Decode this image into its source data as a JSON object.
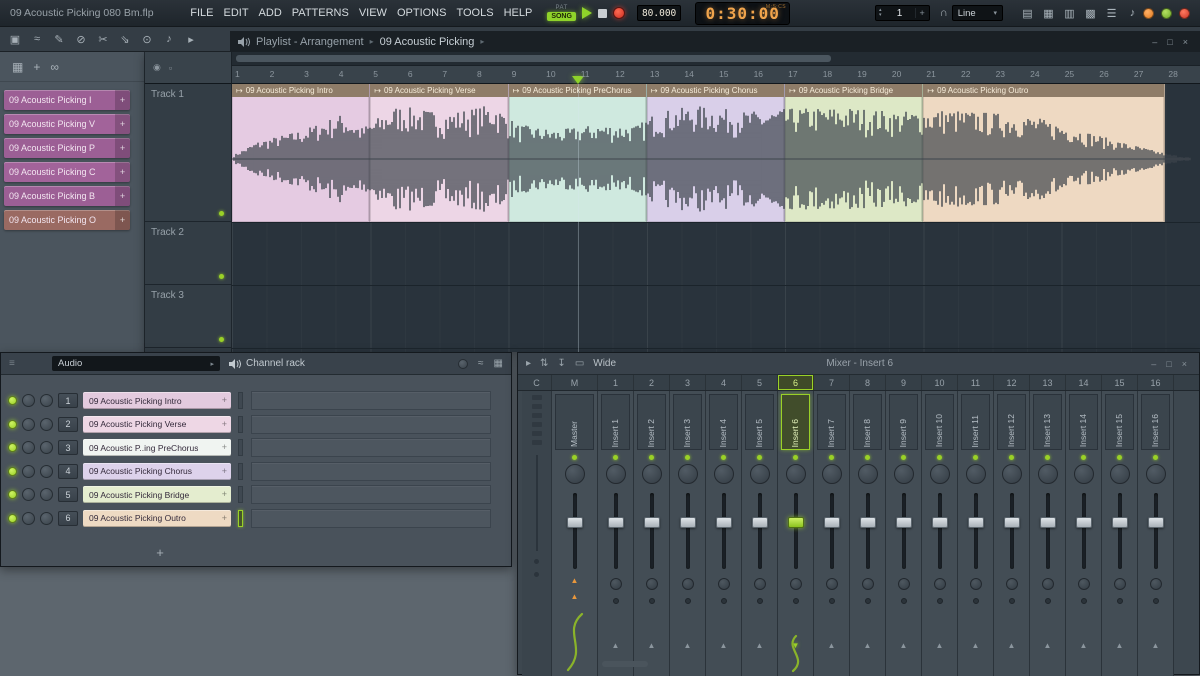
{
  "titlebar": {
    "app_title": "09 Acoustic Picking 080 Bm.flp",
    "menus": [
      "FILE",
      "EDIT",
      "ADD",
      "PATTERNS",
      "VIEW",
      "OPTIONS",
      "TOOLS",
      "HELP"
    ],
    "pat_label": "PAT",
    "song_label": "SONG",
    "tempo": "80.000",
    "time": "0:30:00",
    "time_unit": "M:S:CS",
    "pattern_number": "1",
    "snap_label": "Line",
    "panel_icons": [
      {
        "name": "playlist-toggle-icon",
        "glyph": "▤"
      },
      {
        "name": "piano-roll-toggle-icon",
        "glyph": "▦"
      },
      {
        "name": "channel-rack-toggle-icon",
        "glyph": "▥"
      },
      {
        "name": "mixer-toggle-icon",
        "glyph": "▩"
      },
      {
        "name": "browser-toggle-icon",
        "glyph": "☰"
      },
      {
        "name": "plugin-picker-icon",
        "glyph": "♪"
      }
    ]
  },
  "toolbar2": {
    "icons": [
      {
        "name": "select-tool-icon",
        "glyph": "▣"
      },
      {
        "name": "smooth-tool-icon",
        "glyph": "≈"
      },
      {
        "name": "draw-tool-icon",
        "glyph": "✎"
      },
      {
        "name": "mute-tool-icon",
        "glyph": "⊘"
      },
      {
        "name": "slice-tool-icon",
        "glyph": "✂"
      },
      {
        "name": "slip-tool-icon",
        "glyph": "⇘"
      },
      {
        "name": "zoom-tool-icon",
        "glyph": "⊙"
      },
      {
        "name": "preview-tool-icon",
        "glyph": "♪"
      },
      {
        "name": "playback-tool-icon",
        "glyph": "▸"
      }
    ]
  },
  "picker": {
    "tool_icons": [
      {
        "name": "piano-view-icon",
        "glyph": "▦"
      },
      {
        "name": "move-mode-icon",
        "glyph": "+"
      },
      {
        "name": "link-mode-icon",
        "glyph": "∞"
      }
    ],
    "patterns": [
      {
        "label": "09 Acoustic Picking I",
        "color": "#9c5f95"
      },
      {
        "label": "09 Acoustic Picking V",
        "color": "#a2639a"
      },
      {
        "label": "09 Acoustic Picking P",
        "color": "#9c5f95"
      },
      {
        "label": "09 Acoustic Picking C",
        "color": "#a2639a"
      },
      {
        "label": "09 Acoustic Picking B",
        "color": "#9c5f95"
      },
      {
        "label": "09 Acoustic Picking O",
        "color": "#9a6a62"
      }
    ]
  },
  "playlist": {
    "window_title": "Playlist - Arrangement",
    "window_subtitle": "09 Acoustic Picking",
    "bar_count": 28,
    "playhead_bar": 11,
    "tracks": [
      {
        "name": "Track 1"
      },
      {
        "name": "Track 2"
      },
      {
        "name": "Track 3"
      }
    ],
    "clips": [
      {
        "label": "09 Acoustic Picking Intro",
        "start": 1,
        "end": 5,
        "body": "#e5cbe2",
        "header": "#8e7c68"
      },
      {
        "label": "09 Acoustic Picking Verse",
        "start": 5,
        "end": 9,
        "body": "#edd6e6",
        "header": "#8e7c68"
      },
      {
        "label": "09 Acoustic Picking PreChorus",
        "start": 9,
        "end": 13,
        "body": "#cfe9df",
        "header": "#8e7c68"
      },
      {
        "label": "09 Acoustic Picking Chorus",
        "start": 13,
        "end": 17,
        "body": "#d9cfe9",
        "header": "#8e7c68"
      },
      {
        "label": "09 Acoustic Picking Bridge",
        "start": 17,
        "end": 21,
        "body": "#dde8c6",
        "header": "#8e7c68"
      },
      {
        "label": "09 Acoustic Picking Outro",
        "start": 21,
        "end": 28,
        "body": "#eed9c2",
        "header": "#8e7c68"
      }
    ]
  },
  "channel_rack": {
    "group_label": "Audio",
    "title": "Channel rack",
    "add_label": "+",
    "channels": [
      {
        "num": "1",
        "name": "09 Acoustic Picking Intro",
        "color": "#e3cade"
      },
      {
        "num": "2",
        "name": "09 Acoustic Picking Verse",
        "color": "#eed7e5"
      },
      {
        "num": "3",
        "name": "09 Acoustic P..ing PreChorus",
        "color": "#f0f4f1"
      },
      {
        "num": "4",
        "name": "09 Acoustic Picking Chorus",
        "color": "#ddd2eb"
      },
      {
        "num": "5",
        "name": "09 Acoustic Picking Bridge",
        "color": "#e4edcf"
      },
      {
        "num": "6",
        "name": "09 Acoustic Picking Outro",
        "color": "#eedac3",
        "selected": true
      }
    ]
  },
  "mixer": {
    "window_title": "Mixer - Insert 6",
    "view_label": "Wide",
    "current_header": "C",
    "master_header": "M",
    "master": {
      "label": "Master"
    },
    "selected": 6,
    "header_icons": [
      {
        "name": "mixer-play-icon",
        "glyph": "▸"
      },
      {
        "name": "mixer-swap-icon",
        "glyph": "⇅"
      },
      {
        "name": "mixer-route-icon",
        "glyph": "↧"
      },
      {
        "name": "mixer-dock-icon",
        "glyph": "▭"
      }
    ],
    "inserts": [
      {
        "num": "1",
        "label": "Insert 1"
      },
      {
        "num": "2",
        "label": "Insert 2"
      },
      {
        "num": "3",
        "label": "Insert 3"
      },
      {
        "num": "4",
        "label": "Insert 4"
      },
      {
        "num": "5",
        "label": "Insert 5"
      },
      {
        "num": "6",
        "label": "Insert 6"
      },
      {
        "num": "7",
        "label": "Insert 7"
      },
      {
        "num": "8",
        "label": "Insert 8"
      },
      {
        "num": "9",
        "label": "Insert 9"
      },
      {
        "num": "10",
        "label": "Insert 10"
      },
      {
        "num": "11",
        "label": "Insert 11"
      },
      {
        "num": "12",
        "label": "Insert 12"
      },
      {
        "num": "13",
        "label": "Insert 13"
      },
      {
        "num": "14",
        "label": "Insert 14"
      },
      {
        "num": "15",
        "label": "Insert 15"
      },
      {
        "num": "16",
        "label": "Insert 16"
      }
    ]
  },
  "icons": {
    "clip_arrow": "↦",
    "magnet": "∩",
    "caret_down": "▾",
    "spinner_up": "▴",
    "spinner_down": "▾",
    "plus": "+",
    "breadcrumb": "▸",
    "arrow_up": "▲",
    "arrow_down": "▼",
    "window_min": "–",
    "window_max": "□",
    "window_close": "×",
    "corner_eye": "◉",
    "corner_lock": "▫",
    "grip": "≡"
  },
  "colors": {
    "lime": "#9ad127",
    "amber": "#f0a44c",
    "cable_green": "#8ab32a",
    "record_red": "#d43c30"
  }
}
